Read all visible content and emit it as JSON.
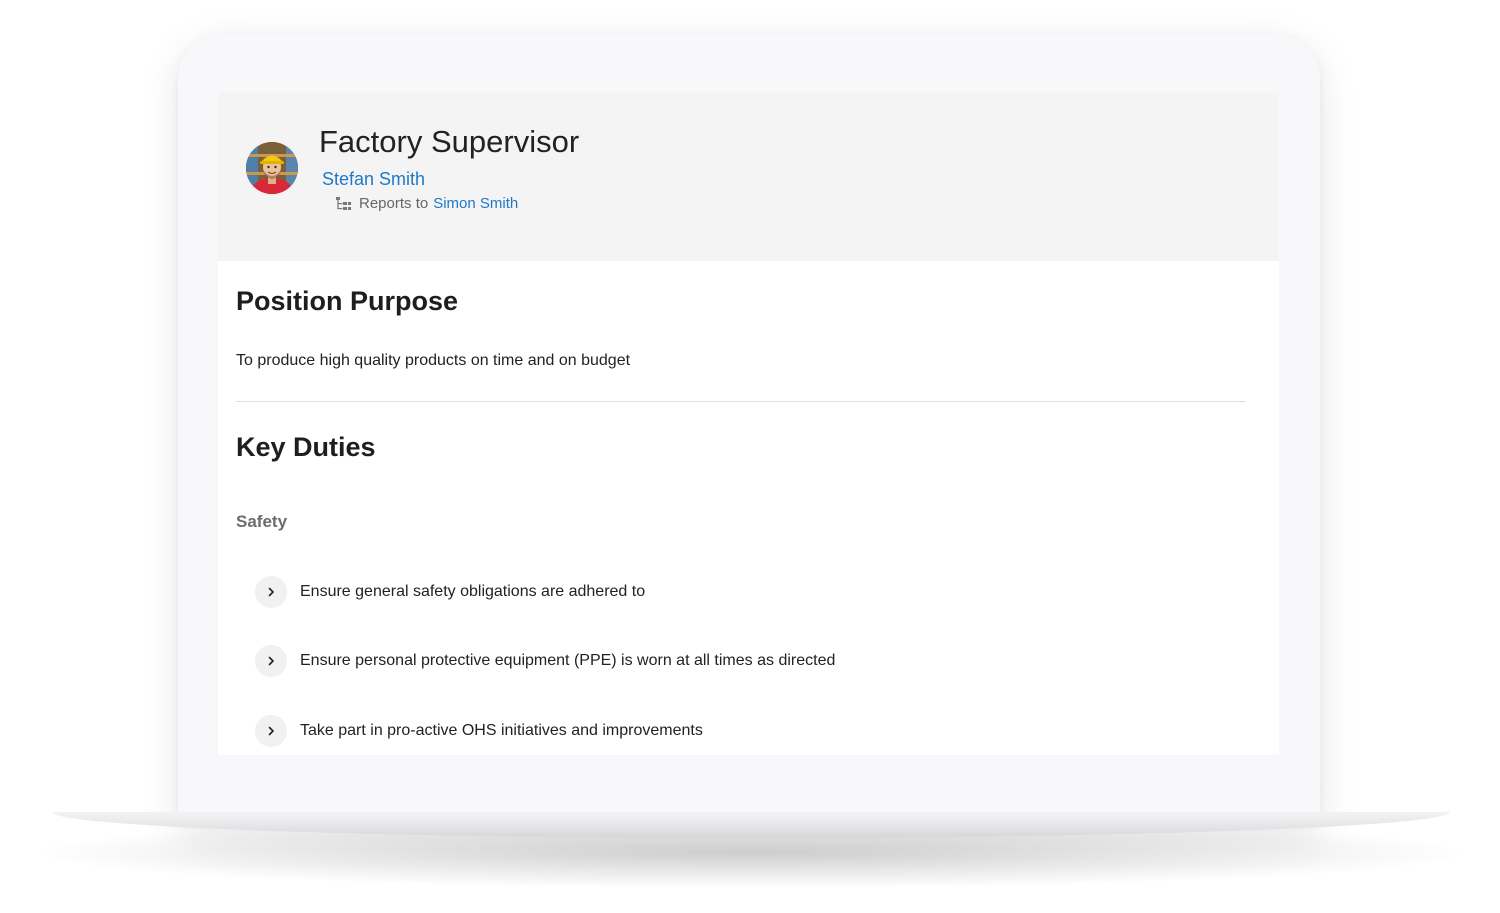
{
  "profile": {
    "position_title": "Factory Supervisor",
    "person_name": "Stefan Smith",
    "reports_to_label": "Reports to",
    "manager_name": "Simon Smith"
  },
  "position_purpose": {
    "heading": "Position Purpose",
    "text": "To produce high quality products on time and on budget"
  },
  "key_duties": {
    "heading": "Key Duties",
    "categories": [
      {
        "name": "Safety",
        "items": [
          "Ensure general safety obligations are adhered to",
          "Ensure personal protective equipment (PPE) is worn at all times as directed",
          "Take part in pro-active OHS initiatives and improvements"
        ]
      }
    ]
  },
  "icons": {
    "avatar": "worker-avatar-icon",
    "reports_to": "org-chart-icon",
    "duty_expand": "chevron-right-icon"
  },
  "colors": {
    "link": "#1f78c8",
    "header_bg": "#f4f4f4",
    "subsection": "#6c6c6c"
  }
}
